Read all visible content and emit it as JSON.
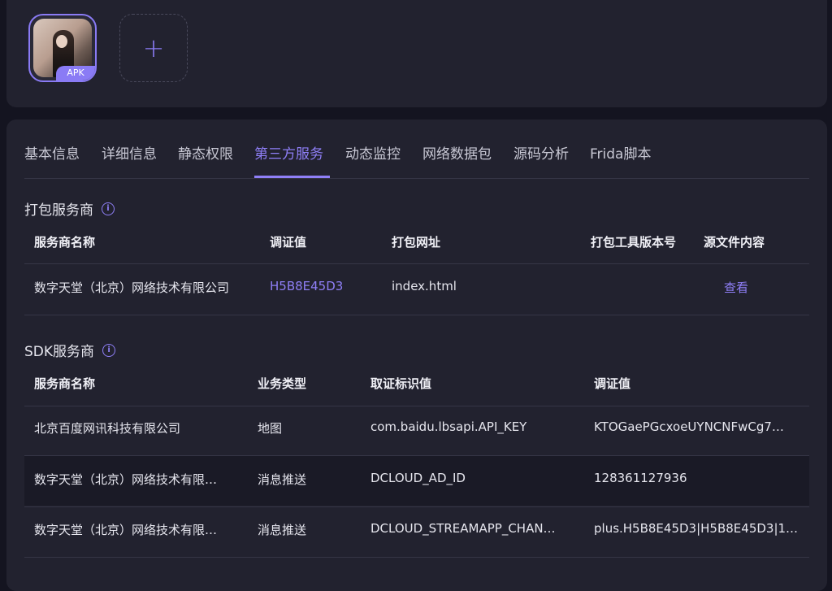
{
  "upload": {
    "badge": "APK",
    "add_symbol": "+"
  },
  "tabs": [
    "基本信息",
    "详细信息",
    "静态权限",
    "第三方服务",
    "动态监控",
    "网络数据包",
    "源码分析",
    "Frida脚本"
  ],
  "active_tab": "第三方服务",
  "packer": {
    "title": "打包服务商",
    "headers": [
      "服务商名称",
      "调证值",
      "打包网址",
      "打包工具版本号",
      "源文件内容"
    ],
    "row": {
      "vendor": "数字天堂（北京）网络技术有限公司",
      "evidence": "H5B8E45D3",
      "url": "index.html",
      "version": "",
      "action": "查看"
    }
  },
  "sdk": {
    "title": "SDK服务商",
    "headers": [
      "服务商名称",
      "业务类型",
      "取证标识值",
      "调证值"
    ],
    "rows": [
      {
        "vendor": "北京百度网讯科技有限公司",
        "type": "地图",
        "key": "com.baidu.lbsapi.API_KEY",
        "value": "KTOGaePGcxoeUYNCNFwCg7…"
      },
      {
        "vendor": "数字天堂（北京）网络技术有限…",
        "type": "消息推送",
        "key": "DCLOUD_AD_ID",
        "value": "128361127936"
      },
      {
        "vendor": "数字天堂（北京）网络技术有限…",
        "type": "消息推送",
        "key": "DCLOUD_STREAMAPP_CHAN…",
        "value": "plus.H5B8E45D3|H5B8E45D3|1…"
      }
    ]
  },
  "colors": {
    "accent": "#8f7ff7",
    "card": "#22222f",
    "background": "#141420"
  }
}
